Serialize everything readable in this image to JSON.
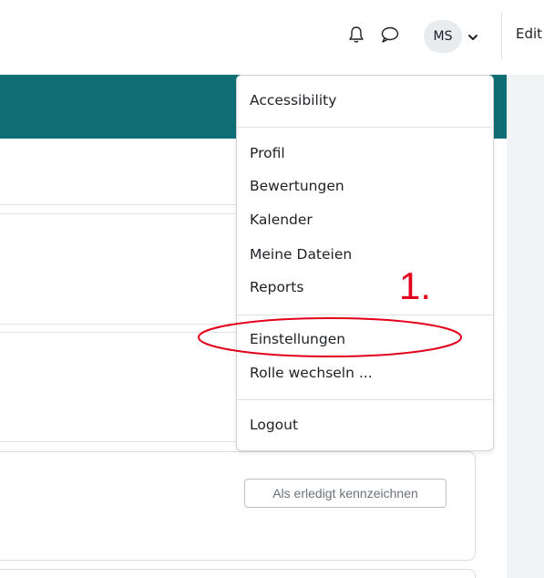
{
  "navbar": {
    "icons": [
      "bell-icon",
      "chat-icon",
      "chevron-down-icon"
    ],
    "avatar_initials": "MS",
    "edit_label": "Edit"
  },
  "user_menu": {
    "items": [
      {
        "label": "Accessibility"
      },
      {
        "label": "Profil"
      },
      {
        "label": "Bewertungen"
      },
      {
        "label": "Kalender"
      },
      {
        "label": "Meine Dateien"
      },
      {
        "label": "Reports"
      },
      {
        "label": "Einstellungen"
      },
      {
        "label": "Rolle wechseln ..."
      },
      {
        "label": "Logout"
      }
    ]
  },
  "content": {
    "mark_done_label": "Als erledigt kennzeichnen"
  },
  "annotation": {
    "number": "1.",
    "color": "#e3001b"
  },
  "colors": {
    "teal_header": "#0f6e75",
    "avatar_bg": "#e9ecef"
  }
}
